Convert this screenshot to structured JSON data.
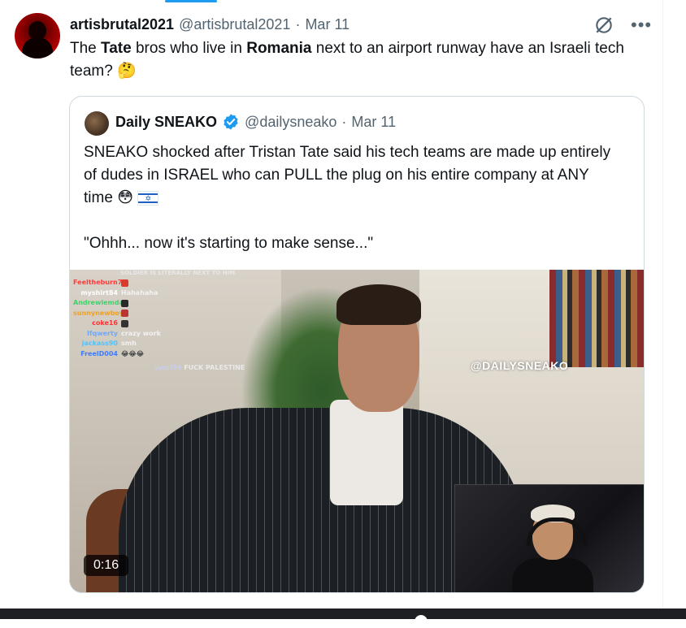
{
  "tweet": {
    "display_name": "artisbrutal2021",
    "handle": "@artisbrutal2021",
    "separator": "·",
    "date": "Mar 11",
    "text_parts": [
      "The ",
      "Tate",
      " bros who live in ",
      "Romania",
      " next to an airport runway have an Israeli tech team? "
    ],
    "emoji": "🤔"
  },
  "quote": {
    "display_name": "Daily SNEAKO",
    "handle": "@dailysneako",
    "separator": "·",
    "date": "Mar 11",
    "text": "SNEAKO shocked after Tristan Tate said his tech teams are made up entirely of dudes in ISRAEL who can PULL the plug on his entire company at ANY time ",
    "emoji": "😳",
    "quote_line": "\"Ohhh... now it's starting to make sense...\""
  },
  "video": {
    "time": "0:16",
    "watermark": "@DAILYSNEAKO",
    "chat_top": "SOLDIER IS LITERALLY NEXT TO HIM",
    "chat": [
      {
        "user": "Feeltheburn77",
        "msg": "",
        "color": "#ff3b3b"
      },
      {
        "user": "myshirt84",
        "msg": "Hahahaha",
        "color": "#ffffff"
      },
      {
        "user": "Andrewlemdas",
        "msg": "",
        "color": "#3fd26b"
      },
      {
        "user": "sunnynewboy",
        "msg": "",
        "color": "#f0a020"
      },
      {
        "user": "coke16",
        "msg": "",
        "color": "#ff3333"
      },
      {
        "user": "Ifqwerty",
        "msg": "crazy work",
        "color": "#6fa8ff"
      },
      {
        "user": "jackass90",
        "msg": "smh",
        "color": "#4fc3ff"
      },
      {
        "user": "FreelD004",
        "msg": "",
        "color": "#3f7bff"
      }
    ],
    "chat_last": "FUCK PALESTINE",
    "chat_last_user": "yuss786"
  },
  "colors": {
    "accent": "#1d9bf0",
    "text": "#0f1419",
    "muted": "#536471",
    "border": "#cfd9de"
  },
  "icons": [
    "grok-icon",
    "more-icon",
    "verified-badge-icon",
    "israel-flag-icon"
  ]
}
